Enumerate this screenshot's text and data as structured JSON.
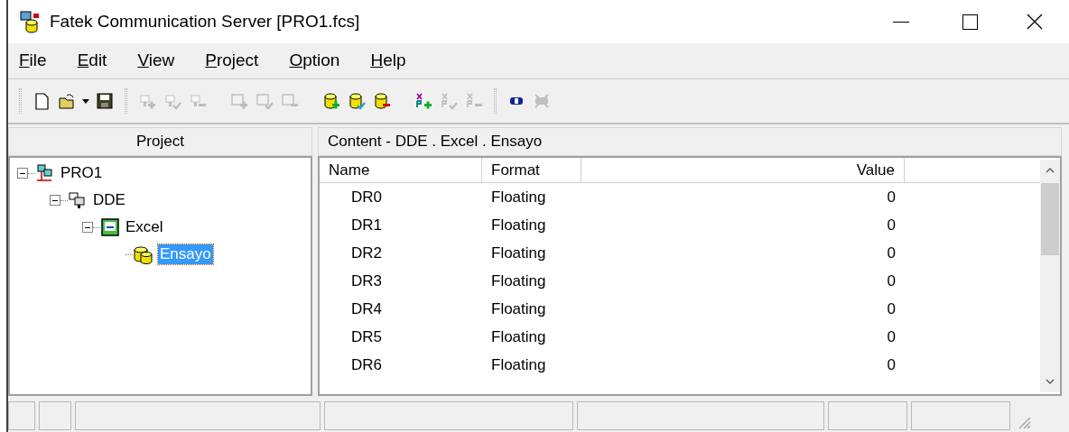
{
  "window": {
    "title": "Fatek Communication Server [PRO1.fcs]"
  },
  "menu": [
    {
      "label": "File",
      "mnemonic": true
    },
    {
      "label": "Edit",
      "mnemonic": true
    },
    {
      "label": "View",
      "mnemonic": true
    },
    {
      "label": "Project",
      "mnemonic": true
    },
    {
      "label": "Option",
      "mnemonic": true
    },
    {
      "label": "Help",
      "mnemonic": true
    }
  ],
  "toolbar": [
    [
      {
        "kind": "new",
        "disabled": false
      },
      {
        "kind": "open",
        "disabled": false
      },
      {
        "kind": "save",
        "disabled": false
      }
    ],
    [
      {
        "kind": "plug-add",
        "disabled": true
      },
      {
        "kind": "plug-check",
        "disabled": true
      },
      {
        "kind": "plug-remove",
        "disabled": true
      },
      {
        "kind": "screen-add",
        "disabled": true
      },
      {
        "kind": "screen-check",
        "disabled": true
      },
      {
        "kind": "screen-remove",
        "disabled": true
      },
      {
        "kind": "db-add",
        "disabled": false
      },
      {
        "kind": "db-check",
        "disabled": false
      },
      {
        "kind": "db-remove",
        "disabled": false
      },
      {
        "kind": "xr-add",
        "disabled": false
      },
      {
        "kind": "xr-check",
        "disabled": true
      },
      {
        "kind": "xr-remove",
        "disabled": true
      }
    ],
    [
      {
        "kind": "connect",
        "disabled": false
      },
      {
        "kind": "disconnect",
        "disabled": true
      }
    ]
  ],
  "project_panel": {
    "header": "Project",
    "tree": [
      {
        "label": "PRO1",
        "kind": "project",
        "expanded": true,
        "selected": false,
        "children": [
          {
            "label": "DDE",
            "kind": "plug",
            "expanded": true,
            "selected": false,
            "children": [
              {
                "label": "Excel",
                "kind": "screen",
                "expanded": true,
                "selected": false,
                "children": [
                  {
                    "label": "Ensayo",
                    "kind": "db",
                    "selected": true
                  }
                ]
              }
            ]
          }
        ]
      }
    ]
  },
  "content_panel": {
    "header": "Content - DDE . Excel . Ensayo",
    "columns": [
      "Name",
      "Format",
      "Value"
    ],
    "rows": [
      [
        "DR0",
        "Floating",
        "0"
      ],
      [
        "DR1",
        "Floating",
        "0"
      ],
      [
        "DR2",
        "Floating",
        "0"
      ],
      [
        "DR3",
        "Floating",
        "0"
      ],
      [
        "DR4",
        "Floating",
        "0"
      ],
      [
        "DR5",
        "Floating",
        "0"
      ],
      [
        "DR6",
        "Floating",
        "0"
      ]
    ]
  }
}
